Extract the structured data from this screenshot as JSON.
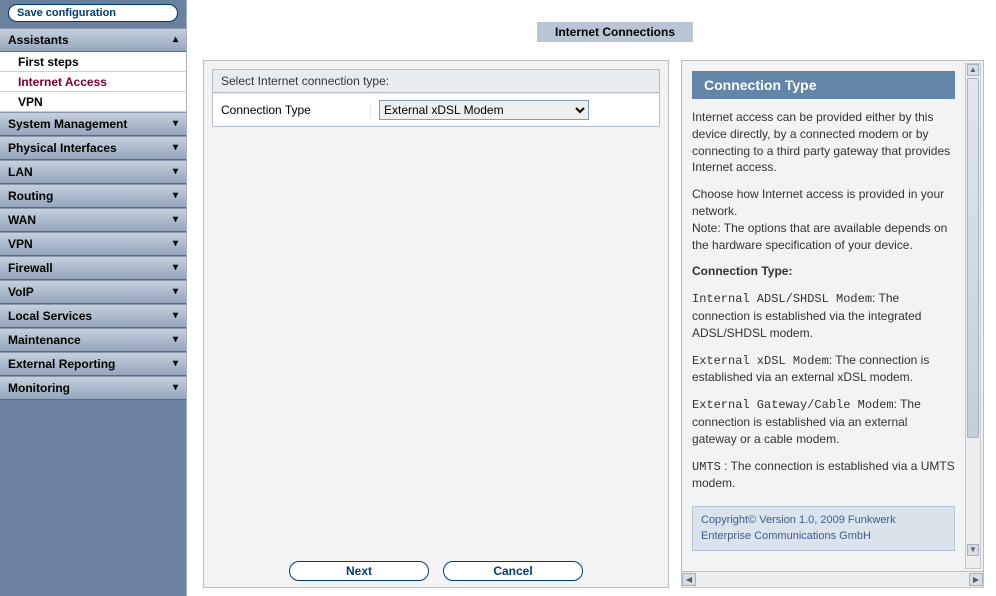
{
  "save_label": "Save configuration",
  "page_title": "Internet Connections",
  "sidebar": {
    "groups": [
      {
        "label": "Assistants",
        "expanded": true,
        "items": [
          {
            "label": "First steps",
            "active": false
          },
          {
            "label": "Internet Access",
            "active": true
          },
          {
            "label": "VPN",
            "active": false
          }
        ]
      },
      {
        "label": "System Management"
      },
      {
        "label": "Physical Interfaces"
      },
      {
        "label": "LAN"
      },
      {
        "label": "Routing"
      },
      {
        "label": "WAN"
      },
      {
        "label": "VPN"
      },
      {
        "label": "Firewall"
      },
      {
        "label": "VoIP"
      },
      {
        "label": "Local Services"
      },
      {
        "label": "Maintenance"
      },
      {
        "label": "External Reporting"
      },
      {
        "label": "Monitoring"
      }
    ]
  },
  "form": {
    "section_title": "Select Internet connection type:",
    "row_label": "Connection Type",
    "selected": "External xDSL Modem"
  },
  "actions": {
    "next": "Next",
    "cancel": "Cancel"
  },
  "help": {
    "title": "Connection Type",
    "p1": "Internet access can be provided either by this device directly, by a connected modem or by connecting to a third party gateway that provides Internet access.",
    "p2a": "Choose how Internet access is provided in your network.",
    "p2b": "Note: The options that are available depends on the hardware specification of your device.",
    "heading": "Connection Type:",
    "opt1_name": "Internal ADSL/SHDSL Modem",
    "opt1_desc": ": The connection is established via the integrated ADSL/SHDSL modem.",
    "opt2_name": "External xDSL Modem",
    "opt2_desc": ": The connection is established via an external xDSL modem.",
    "opt3_name": "External Gateway/Cable Modem",
    "opt3_desc": ": The connection is established via an external gateway or a cable modem.",
    "opt4_name": "UMTS",
    "opt4_desc": " : The connection is established via a UMTS modem.",
    "copyright": "Copyright© Version 1.0, 2009 Funkwerk Enterprise Communications GmbH"
  }
}
